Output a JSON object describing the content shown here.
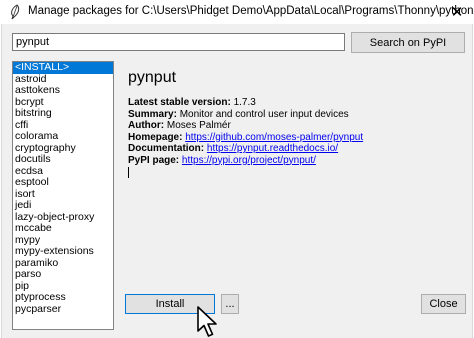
{
  "window": {
    "title": "Manage packages for C:\\Users\\Phidget Demo\\AppData\\Local\\Programs\\Thonny\\python.exe",
    "close_glyph": "✕"
  },
  "search": {
    "value": "pynput",
    "button_label": "Search on PyPI"
  },
  "packages": {
    "items": [
      "<INSTALL>",
      "astroid",
      "asttokens",
      "bcrypt",
      "bitstring",
      "cffi",
      "colorama",
      "cryptography",
      "docutils",
      "ecdsa",
      "esptool",
      "isort",
      "jedi",
      "lazy-object-proxy",
      "mccabe",
      "mypy",
      "mypy-extensions",
      "paramiko",
      "parso",
      "pip",
      "ptyprocess",
      "pycparser"
    ],
    "selected_index": 0
  },
  "details": {
    "name": "pynput",
    "latest_label": "Latest stable version:",
    "latest_value": "1.7.3",
    "summary_label": "Summary:",
    "summary_value": "Monitor and control user input devices",
    "author_label": "Author:",
    "author_value": "Moses Palmér",
    "homepage_label": "Homepage:",
    "homepage_url": "https://github.com/moses-palmer/pynput",
    "documentation_label": "Documentation:",
    "documentation_url": "https://pynput.readthedocs.io/",
    "pypi_label": "PyPI page:",
    "pypi_url": "https://pypi.org/project/pynput/"
  },
  "buttons": {
    "install": "Install",
    "more": "...",
    "close": "Close"
  },
  "icons": {
    "app": "thonny-feather-icon",
    "cursor": "mouse-pointer-icon"
  }
}
